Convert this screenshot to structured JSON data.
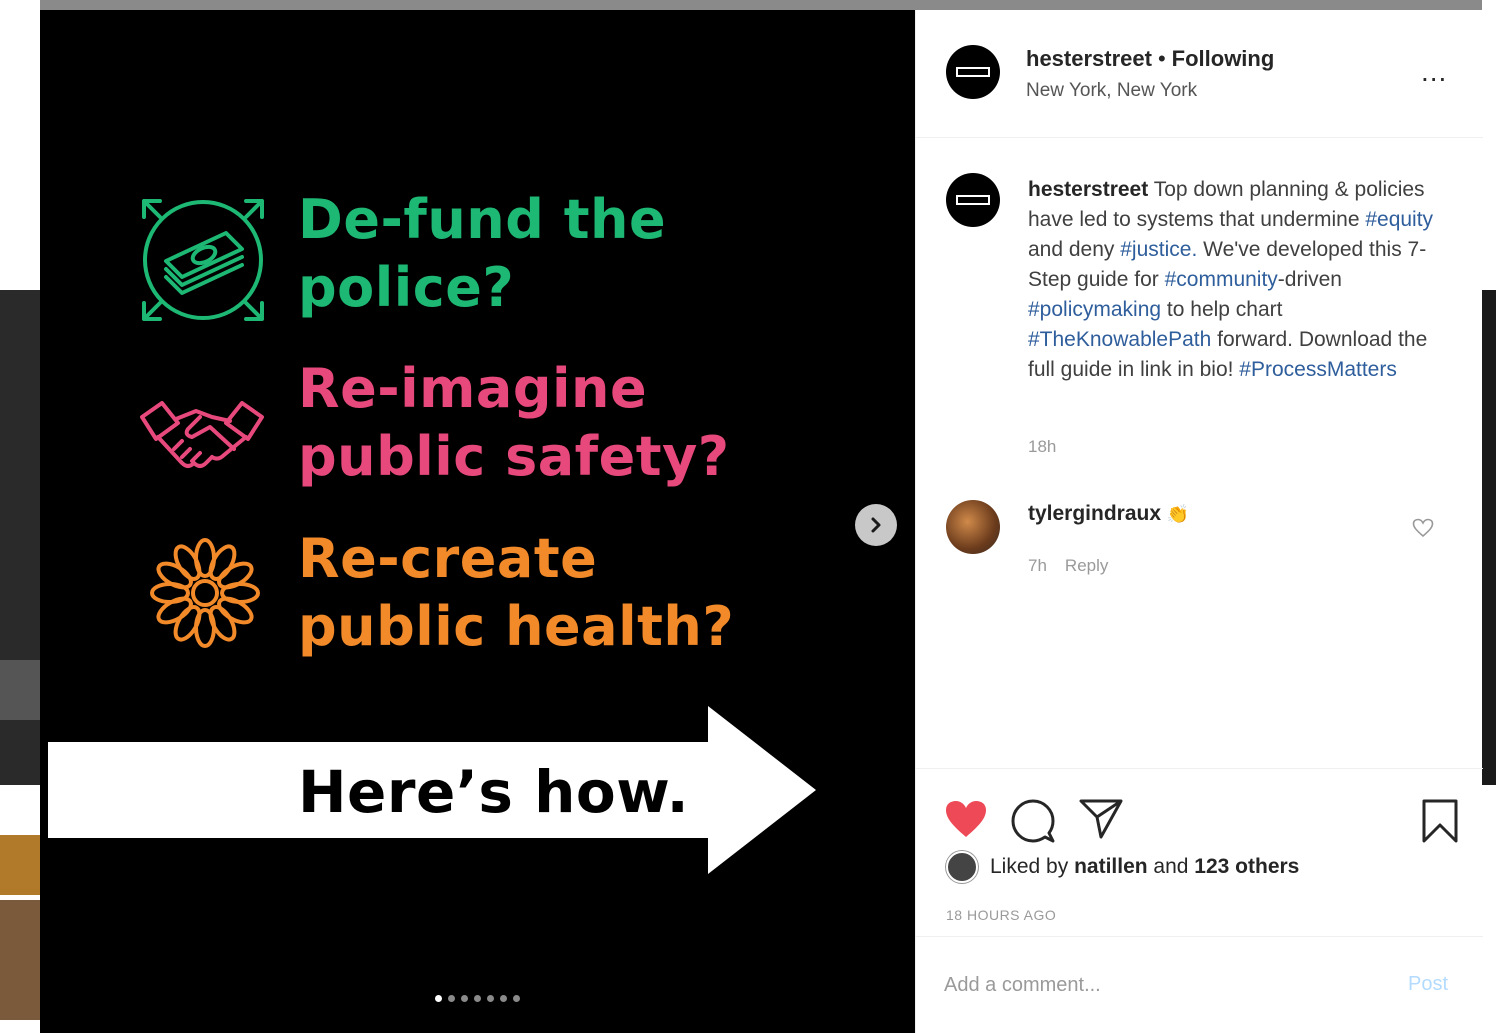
{
  "media": {
    "lines": {
      "defund": [
        "De-fund the",
        "police?"
      ],
      "reimagine": [
        "Re-imagine",
        "public safety?"
      ],
      "recreate": [
        "Re-create",
        "public health?"
      ]
    },
    "cta": "Here’s how.",
    "colors": {
      "green": "#1db873",
      "pink": "#e8497c",
      "orange": "#f28a2a"
    },
    "icons": {
      "defund": "money-stack-icon",
      "reimagine": "handshake-icon",
      "recreate": "flower-icon",
      "next": "chevron-right-icon"
    },
    "slide_count": 7,
    "active_slide": 1
  },
  "header": {
    "username": "hesterstreet",
    "separator": "•",
    "follow_status": "Following",
    "location": "New York, New York",
    "more": "..."
  },
  "caption": {
    "username": "hesterstreet",
    "segments": [
      {
        "t": "Top down planning & policies have led to systems that undermine "
      },
      {
        "t": "#equity",
        "tag": true
      },
      {
        "t": " and deny "
      },
      {
        "t": "#justice.",
        "tag": true
      },
      {
        "t": " We've developed this 7-Step guide for "
      },
      {
        "t": "#community",
        "tag": true
      },
      {
        "t": "-driven "
      },
      {
        "t": "#policymaking",
        "tag": true
      },
      {
        "t": " to help chart "
      },
      {
        "t": "#TheKnowablePath",
        "tag": true
      },
      {
        "t": " forward. Download the full guide in link in bio! "
      },
      {
        "t": "#ProcessMatters",
        "tag": true
      }
    ],
    "time": "18h"
  },
  "comment": {
    "username": "tylergindraux",
    "emoji": "👏",
    "time": "7h",
    "reply": "Reply"
  },
  "actions": {
    "liked_prefix": "Liked by ",
    "liked_user": "natillen",
    "liked_middle": " and ",
    "liked_others": "123 others",
    "age": "18 HOURS AGO",
    "like_color": "#ed4956"
  },
  "comment_box": {
    "placeholder": "Add a comment...",
    "post": "Post"
  }
}
